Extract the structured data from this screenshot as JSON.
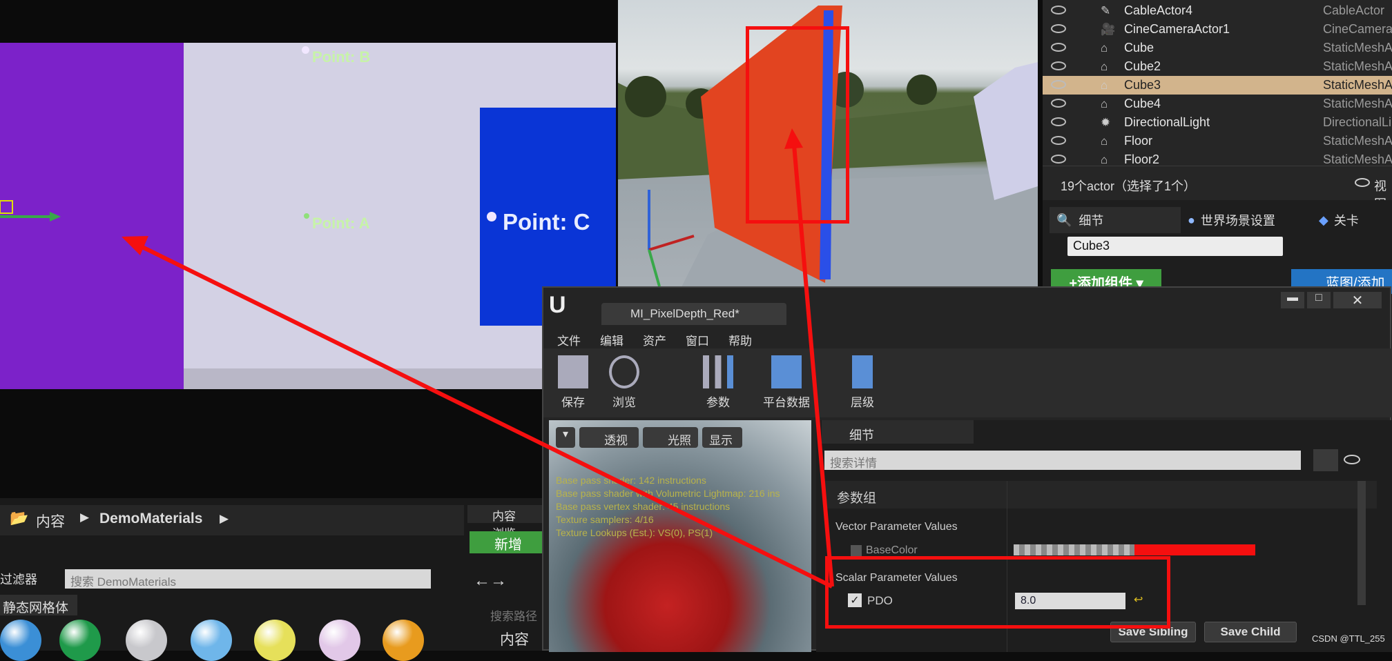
{
  "viewport_left": {
    "points": [
      {
        "label": "Point: B"
      },
      {
        "label": "Point: A"
      },
      {
        "label": "Point: C"
      }
    ]
  },
  "outliner": {
    "rows": [
      {
        "name": "CableActor4",
        "type": "CableActor",
        "icon": "cable-icon",
        "selected": false
      },
      {
        "name": "CineCameraActor1",
        "type": "CineCameraA",
        "icon": "camera-icon",
        "selected": false
      },
      {
        "name": "Cube",
        "type": "StaticMeshA",
        "icon": "static-mesh-icon",
        "selected": false
      },
      {
        "name": "Cube2",
        "type": "StaticMeshA",
        "icon": "static-mesh-icon",
        "selected": false
      },
      {
        "name": "Cube3",
        "type": "StaticMeshA",
        "icon": "static-mesh-icon",
        "selected": true
      },
      {
        "name": "Cube4",
        "type": "StaticMeshA",
        "icon": "static-mesh-icon",
        "selected": false
      },
      {
        "name": "DirectionalLight",
        "type": "DirectionalLi",
        "icon": "light-icon",
        "selected": false
      },
      {
        "name": "Floor",
        "type": "StaticMeshA",
        "icon": "static-mesh-icon",
        "selected": false
      },
      {
        "name": "Floor2",
        "type": "StaticMeshA",
        "icon": "static-mesh-icon",
        "selected": false
      }
    ],
    "footer": "19个actor（选择了1个）",
    "view_label": "视图"
  },
  "details": {
    "tabs": [
      "细节",
      "世界场景设置",
      "关卡"
    ],
    "name_value": "Cube3",
    "add_component": "+添加组件 ▾",
    "blueprint": "蓝图/添加"
  },
  "material_editor": {
    "tab_title": "MI_PixelDepth_Red*",
    "menu": [
      "文件",
      "编辑",
      "资产",
      "窗口",
      "帮助"
    ],
    "toolbar": [
      "保存",
      "浏览",
      "参数",
      "平台数据",
      "层级"
    ],
    "viewport_buttons": [
      "透视",
      "光照",
      "显示"
    ],
    "stats": [
      "Base pass shader: 142 instructions",
      "Base pass shader with Volumetric Lightmap: 216 ins",
      "Base pass vertex shader: 45 instructions",
      "Texture samplers: 4/16",
      "Texture Lookups (Est.): VS(0), PS(1)"
    ],
    "details_tab": "细节",
    "search_placeholder": "搜索详情",
    "group": "参数组",
    "vector_section": "Vector Parameter Values",
    "base_color": "BaseColor",
    "scalar_section": "Scalar Parameter Values",
    "pdo_label": "PDO",
    "pdo_value": "8.0",
    "save_sibling": "Save Sibling",
    "save_child": "Save Child"
  },
  "content_browser": {
    "crumbs": [
      "内容",
      "DemoMaterials"
    ],
    "filter": "过滤器",
    "search_placeholder": "搜索 DemoMaterials",
    "category": "静态网格体",
    "tab": "内容浏览",
    "add_new": "新增",
    "search_path_placeholder": "搜索路径",
    "root": "内容",
    "balls": [
      "#3b8fd6",
      "#1f9a4a",
      "#c8c8cc",
      "#6fb6ea",
      "#e6e05a",
      "#e2c8e8",
      "#e89b1e"
    ]
  },
  "watermark": "CSDN @TTL_255",
  "colors": {
    "annotation": "#f50f0f",
    "selection": "#d2b48c",
    "purple": "#7c22c9",
    "blue_panel": "#0a35d6"
  }
}
